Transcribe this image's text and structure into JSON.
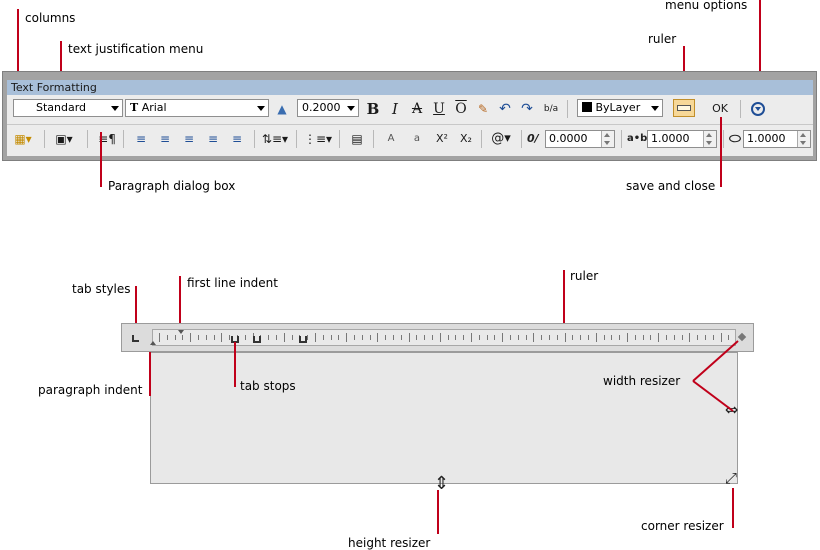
{
  "callouts": {
    "columns": "columns",
    "text_justification_menu": "text justification menu",
    "menu_options": "menu options",
    "ruler_top": "ruler",
    "paragraph_dialog_box": "Paragraph dialog box",
    "save_and_close": "save and close",
    "tab_styles": "tab styles",
    "first_line_indent": "first line indent",
    "ruler_bottom": "ruler",
    "paragraph_indent": "paragraph indent",
    "tab_stops": "tab stops",
    "width_resizer": "width resizer",
    "height_resizer": "height resizer",
    "corner_resizer": "corner resizer"
  },
  "toolbar": {
    "title": "Text Formatting",
    "style": "Standard",
    "font": "Arial",
    "font_prefix": "T",
    "height": "0.2000",
    "color": "ByLayer",
    "ok_label": "OK",
    "bold": "B",
    "italic": "I",
    "strike": "A",
    "underline": "U",
    "overline": "O",
    "undo": "↶",
    "redo": "↷",
    "stack": "b/a",
    "oblique_value": "0.0000",
    "tracking_value": "1.0000",
    "width_value": "1.0000",
    "oblique_symbol": "0/",
    "tracking_symbol": "a•b",
    "symbol": "@",
    "superscript": "X²",
    "subscript": "X₂",
    "upper_A": "A",
    "lower_a": "a"
  },
  "icons": [
    "columns-icon",
    "text-justification-icon",
    "paragraph-icon",
    "align-left-icon",
    "align-center-icon",
    "align-right-icon",
    "justify-icon",
    "distribute-icon",
    "line-spacing-icon",
    "numbering-icon",
    "insert-field-icon",
    "uppercase-icon",
    "lowercase-icon",
    "superscript-icon",
    "subscript-icon",
    "symbol-icon",
    "ruler-icon",
    "menu-options-icon",
    "annotative-icon",
    "background-mask-icon"
  ],
  "colors": {
    "accent_red": "#c0001a",
    "title_bar": "#a8bfd9",
    "toolbar_bg": "#ececec"
  }
}
